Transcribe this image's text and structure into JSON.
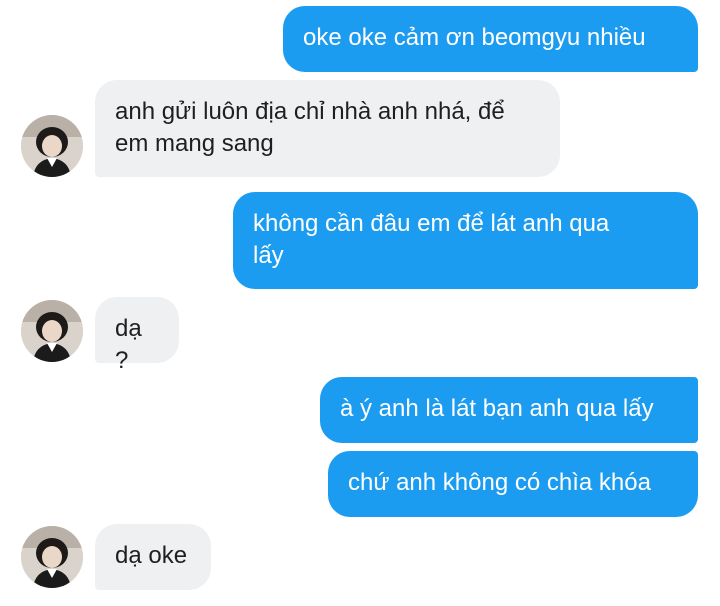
{
  "conversation": {
    "messages": [
      {
        "sender": "me",
        "text": "oke oke cảm ơn beomgyu nhiều"
      },
      {
        "sender": "contact",
        "text": "anh gửi luôn địa chỉ nhà anh nhá, để\nem mang sang"
      },
      {
        "sender": "me",
        "text": "không cần đâu em để lát anh qua\nlấy"
      },
      {
        "sender": "contact",
        "text": "dạ ?"
      },
      {
        "sender": "me",
        "text": "à ý anh là lát bạn anh qua lấy"
      },
      {
        "sender": "me",
        "text": "chứ anh không có chìa khóa"
      },
      {
        "sender": "contact",
        "text": "dạ oke"
      }
    ]
  },
  "colors": {
    "outgoing_bubble": "#1c9cf0",
    "incoming_bubble": "#eef0f2",
    "outgoing_text": "#ffffff",
    "incoming_text": "#1f1f1f"
  },
  "icons": {
    "avatar": "contact-avatar-photo"
  }
}
